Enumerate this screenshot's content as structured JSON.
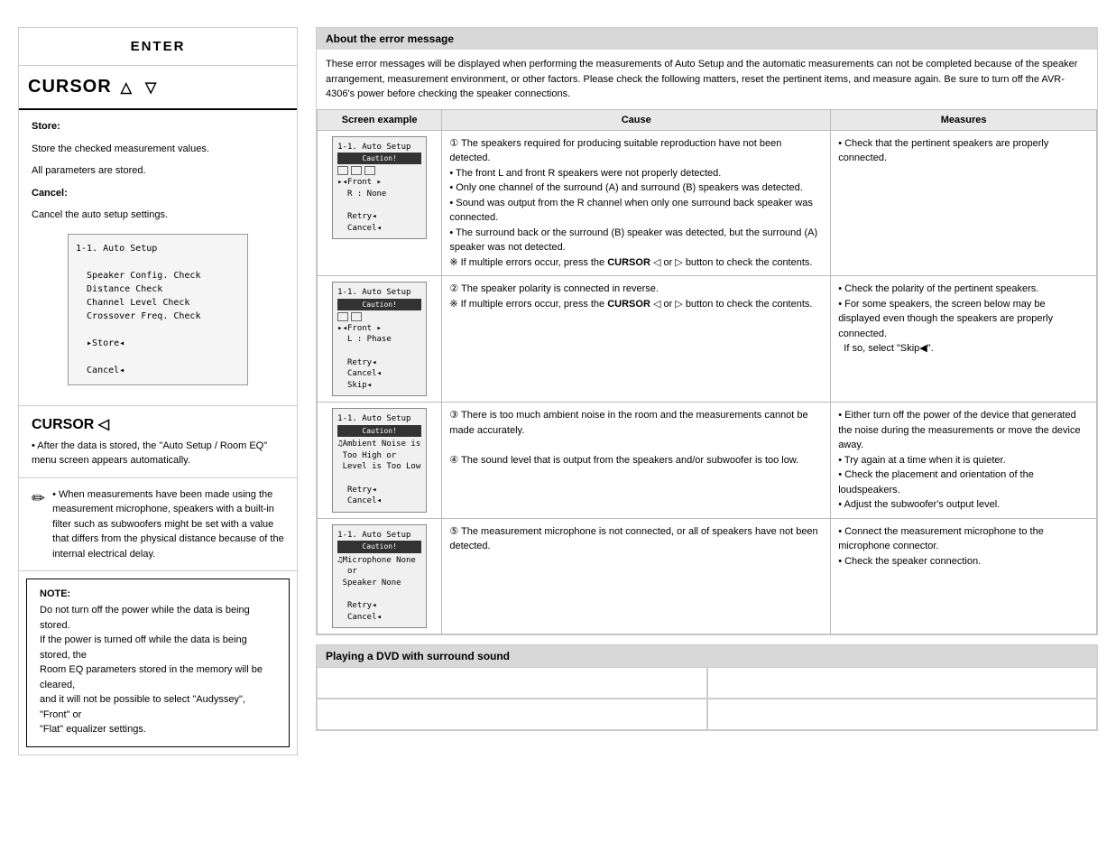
{
  "left": {
    "enter_title": "ENTER",
    "cursor_label": "CURSOR",
    "cursor_up_arrow": "△",
    "cursor_down_arrow": "▽",
    "store_title": "Store:",
    "store_text1": "Store the checked measurement values.",
    "store_text2": "All parameters are stored.",
    "cancel_title": "Cancel:",
    "cancel_text": "Cancel the auto setup settings.",
    "screen_box_lines": [
      "1-1. Auto Setup",
      "",
      "  Speaker Config. Check",
      "  Distance Check",
      "  Channel Level Check",
      "  Crossover Freq. Check",
      "",
      "  ▶Store◀",
      "",
      "  Cancel◀"
    ],
    "cursor_left_title": "CURSOR ◁",
    "cursor_left_text1": "• After the data is stored, the \"Auto Setup / Room EQ\"",
    "cursor_left_text2": "  menu screen appears automatically.",
    "pencil_note": "• When measurements have been made using the measurement microphone, speakers with a built-in filter such as subwoofers might be set with a value that differs from the physical distance because of the internal electrical delay.",
    "note_title": "NOTE:",
    "note_lines": [
      "• Do not turn off the power while the data is being stored.",
      "  If the power is turned off while the data is being stored, the",
      "  Room EQ parameters stored in the memory will be cleared,",
      "  and it will not be possible to select \"Audyssey\", \"Front\" or",
      "  \"Flat\" equalizer settings."
    ]
  },
  "right": {
    "error_header": "About the error message",
    "error_intro": "These error messages will be displayed when performing the measurements of Auto Setup and the automatic measurements can not be completed because of the speaker arrangement, measurement environment, or other factors. Please check the following matters, reset the pertinent items, and measure again. Be sure to turn off the AVR-4306's power before checking the speaker connections.",
    "table_headers": [
      "Screen example",
      "Cause",
      "Measures"
    ],
    "rows": [
      {
        "screen_lines": [
          "1-1. Auto Setup",
          "Caution!",
          "▶◀Front ▶",
          "   R : None",
          "",
          "  Retry◀",
          "  Cancel◀"
        ],
        "cause": "① The speakers required for producing suitable reproduction have not been detected.\n• The front L and front R speakers were not properly detected.\n• Only one channel of the surround (A) and surround (B) speakers was detected.\n• Sound was output from the R channel when only one surround back speaker was connected.\n• The surround back or the surround (B) speaker was detected, but the surround (A) speaker was not detected.\n※ If multiple errors occur, press the CURSOR ◁ or ▷ button to check the contents.",
        "measures": "• Check that the pertinent speakers are properly connected."
      },
      {
        "screen_lines": [
          "1-1. Auto Setup",
          "Caution!",
          "▶◀Front ▶",
          "  L : Phase",
          "",
          "  Retry◀",
          "  Cancel◀",
          "  Skip◀"
        ],
        "cause": "② The speaker polarity is connected in reverse.\n※ If multiple errors occur, press the CURSOR ◁ or ▷ button to check the contents.",
        "measures": "• Check the polarity of the pertinent speakers.\n• For some speakers, the screen below may be displayed even though the speakers are properly connected.\n  If so, select \"Skip◀\"."
      },
      {
        "screen_lines": [
          "1-1. Auto Setup",
          "Caution!",
          "♪Ambient Noise is",
          " Too High or",
          " Level is Too Low",
          "",
          "  Retry◀",
          "  Cancel◀"
        ],
        "cause": "③ There is too much ambient noise in the room and the measurements cannot be made accurately.\n\n④ The sound level that is output from the speakers and/or subwoofer is too low.",
        "measures": "• Either turn off the power of the device that generated the noise during the measurements or move the device away.\n• Try again at a time when it is quieter.\n• Check the placement and orientation of the loudspeakers.\n• Adjust the subwoofer's output level."
      },
      {
        "screen_lines": [
          "1-1. Auto Setup",
          "Caution!",
          "♪Microphone None",
          "   or",
          " Speaker None",
          "",
          "  Retry◀",
          "  Cancel◀"
        ],
        "cause": "⑤ The measurement microphone is not connected, or all of speakers have not been detected.",
        "measures": "• Connect the measurement microphone to the microphone connector.\n• Check the speaker connection."
      }
    ],
    "dvd_header": "Playing a DVD with surround sound",
    "dvd_cells": [
      "",
      "",
      "",
      ""
    ]
  }
}
